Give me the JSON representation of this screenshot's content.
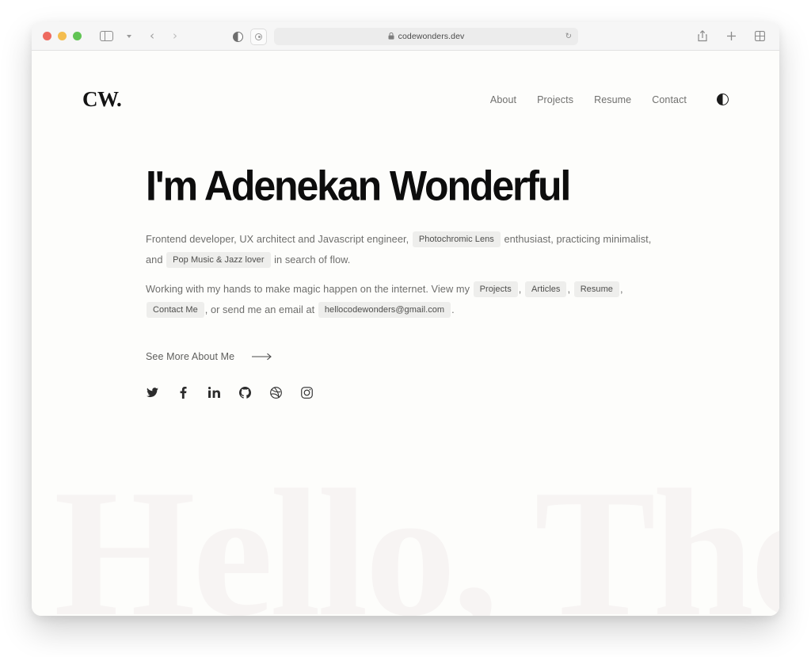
{
  "browser": {
    "traffic_lights": [
      "close",
      "minimize",
      "zoom"
    ],
    "sidebar_button": "sidebar-toggle",
    "tab_group_chevron": "tab-group-chevron",
    "back_label": "‹",
    "forward_label": "›",
    "reader_label": "reader-mode",
    "extension_label": "extension",
    "url": "codewonders.dev",
    "lock": "🔒",
    "reload": "↻",
    "share_label": "share",
    "new_tab_label": "new-tab",
    "tab_overview_label": "tab-overview"
  },
  "site": {
    "logo": "CW",
    "logo_dot": ".",
    "nav": [
      {
        "label": "About"
      },
      {
        "label": "Projects"
      },
      {
        "label": "Resume"
      },
      {
        "label": "Contact"
      }
    ],
    "theme_toggle": "dark-mode-toggle"
  },
  "hero": {
    "title": "I'm Adenekan Wonderful",
    "paragraph1": {
      "part1": "Frontend developer, UX architect and Javascript engineer,",
      "tag1": "Photochromic Lens",
      "part2": "enthusiast, practicing minimalist, and",
      "tag2": "Pop Music & Jazz lover",
      "part3": "in search of flow."
    },
    "paragraph2": {
      "part1": "Working with my hands to make magic happen on the internet. View my",
      "link1": "Projects",
      "sep1": ",",
      "link2": "Articles",
      "sep2": ",",
      "link3": "Resume",
      "sep3": ",",
      "link4": "Contact Me",
      "part2": ", or send me",
      "part3": "an email at",
      "email": "hellocodewonders@gmail.com",
      "period": "."
    },
    "cta": {
      "label": "See More About Me",
      "arrow": "→"
    },
    "socials": [
      {
        "name": "twitter"
      },
      {
        "name": "facebook"
      },
      {
        "name": "linkedin"
      },
      {
        "name": "github"
      },
      {
        "name": "dribbble"
      },
      {
        "name": "instagram"
      }
    ],
    "watermark": "Hello, There."
  },
  "colors": {
    "page_bg": "#fdfdfb",
    "text_dark": "#0d0d0d",
    "text_muted": "#6e6e6c",
    "pill_bg": "#eeeeec",
    "watermark": "#f7f4f3"
  }
}
